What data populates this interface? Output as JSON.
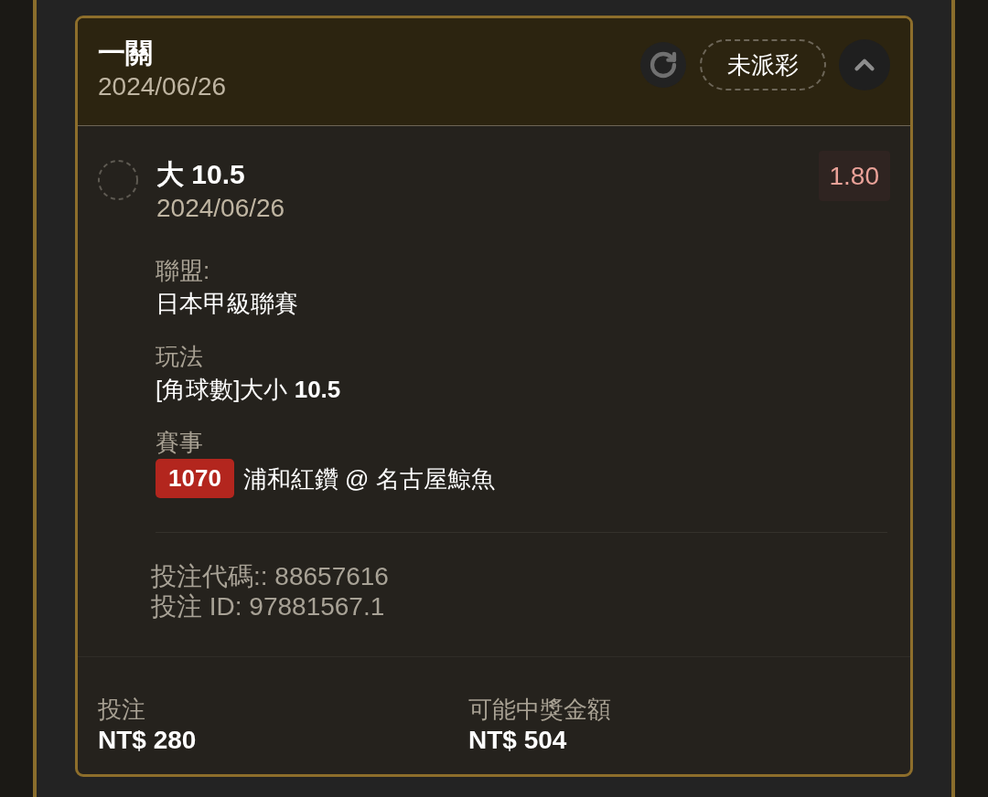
{
  "ticket": {
    "title": "一關",
    "date": "2024/06/26",
    "status": "未派彩",
    "expanded": true
  },
  "selection": {
    "checked": false,
    "name": "大 10.5",
    "date": "2024/06/26",
    "odds": "1.80",
    "details": [
      {
        "kind": "text",
        "label": "聯盟:",
        "value": "日本甲級聯賽"
      },
      {
        "kind": "text",
        "label": "玩法",
        "value": "[角球數]大小 **10.5**"
      },
      {
        "kind": "match",
        "label": "賽事",
        "code": "1070",
        "value": "浦和紅鑽 @ 名古屋鯨魚"
      }
    ],
    "bet_code": "投注代碼:: 88657616",
    "bet_id": "投注 ID: 97881567.1"
  },
  "summary": [
    {
      "label": "投注",
      "value": "NT$ 280"
    },
    {
      "label": "可能中獎金額",
      "value": "NT$ 504"
    }
  ]
}
